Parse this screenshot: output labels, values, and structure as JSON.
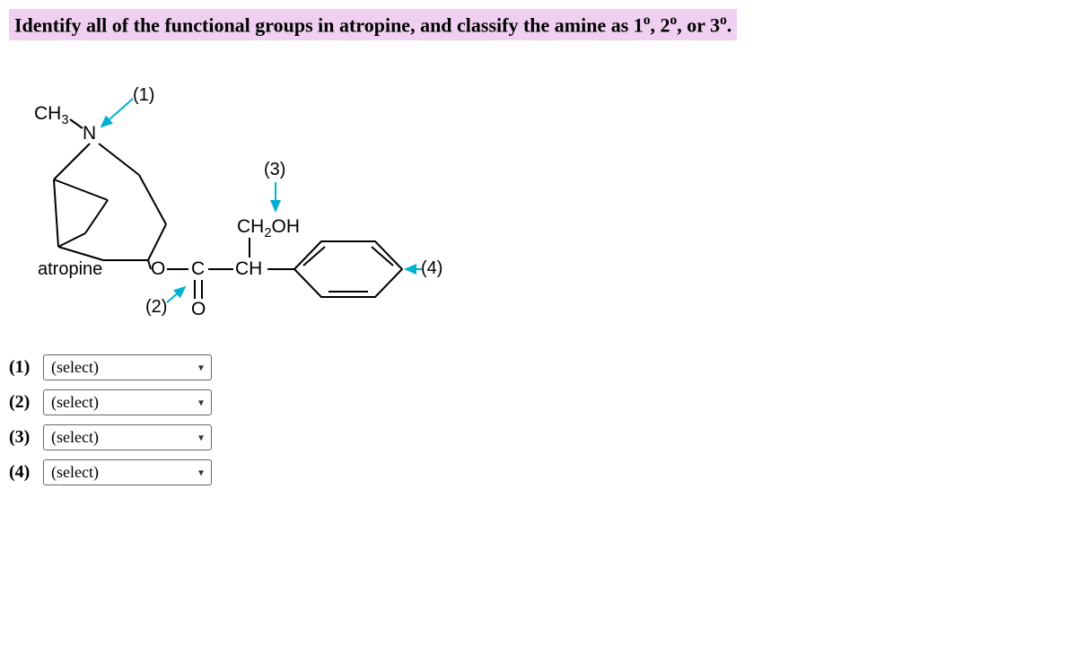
{
  "question": {
    "text_start": "Identify all of the functional groups in atropine, and classify the amine as 1",
    "degree_o": "o",
    "text_mid1": ", 2",
    "text_mid2": ", or 3",
    "text_end": "."
  },
  "structure": {
    "ch3": "CH",
    "ch3_sub": "3",
    "n": "N",
    "atropine": "atropine",
    "ch2oh_ch2": "CH",
    "ch2oh_sub": "2",
    "ch2oh_oh": "OH",
    "o": "O",
    "c": "C",
    "ch": "CH",
    "dbl_o": "O",
    "label1": "(1)",
    "label2": "(2)",
    "label3": "(3)",
    "label4": "(4)"
  },
  "answers": [
    {
      "label": "(1)",
      "value": "(select)"
    },
    {
      "label": "(2)",
      "value": "(select)"
    },
    {
      "label": "(3)",
      "value": "(select)"
    },
    {
      "label": "(4)",
      "value": "(select)"
    }
  ]
}
